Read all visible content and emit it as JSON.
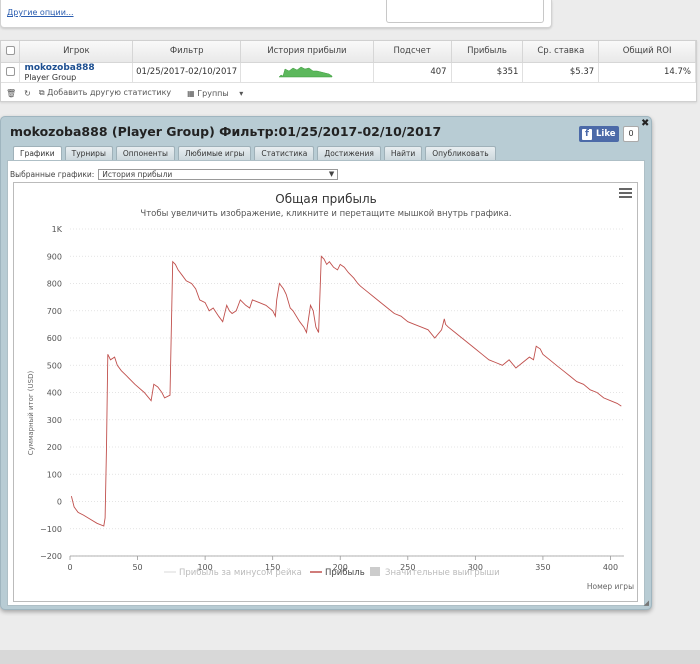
{
  "top_panel": {
    "other_options_link": "Другие опции..."
  },
  "stats_table": {
    "headers": [
      "Игрок",
      "Фильтр",
      "История прибыли",
      "Подсчет",
      "Прибыль",
      "Ср. ставка",
      "Общий ROI"
    ],
    "row": {
      "player_name": "mokozoba888",
      "player_site": "Player Group",
      "filter": "01/25/2017-02/10/2017",
      "count": "407",
      "profit": "$351",
      "avg_stake": "$5.37",
      "roi": "14.7%"
    },
    "toolbar": {
      "add_stat": "Добавить другую статистику",
      "groups": "Группы"
    }
  },
  "window": {
    "title": "mokozoba888 (Player Group) Фильтр:01/25/2017-02/10/2017",
    "fb_like": "Like",
    "fb_count": "0",
    "close": "✖",
    "tabs": [
      "Графики",
      "Турниры",
      "Оппоненты",
      "Любимые игры",
      "Статистика",
      "Достижения",
      "Найти",
      "Опубликовать"
    ],
    "active_tab": 0,
    "selected_charts_label": "Выбранные графики:",
    "selected_charts_value": "История прибыли"
  },
  "chart_data": {
    "type": "line",
    "title": "Общая прибыль",
    "subtitle": "Чтобы увеличить изображение, кликните и перетащите мышкой внутрь графика.",
    "ylabel": "Суммарный итог (USD)",
    "xlabel": "Номер игры",
    "xlim": [
      0,
      410
    ],
    "ylim": [
      -200,
      1000
    ],
    "x_ticks": [
      "0",
      "50",
      "100",
      "150",
      "200",
      "250",
      "300",
      "350",
      "400"
    ],
    "y_ticks": [
      "−200",
      "−100",
      "0",
      "100",
      "200",
      "300",
      "400",
      "500",
      "600",
      "700",
      "800",
      "900",
      "1K"
    ],
    "grid": true,
    "legend_position": "bottom",
    "legend": [
      "Прибыль за минусом рейка",
      "Прибыль",
      "Значительные выигрыши"
    ],
    "series": [
      {
        "name": "Прибыль",
        "color": "#c0504d",
        "x": [
          1,
          3,
          6,
          10,
          15,
          20,
          25,
          26,
          27,
          28,
          30,
          33,
          35,
          38,
          42,
          48,
          55,
          60,
          62,
          65,
          68,
          70,
          74,
          76,
          78,
          80,
          83,
          86,
          90,
          93,
          96,
          100,
          103,
          106,
          110,
          113,
          116,
          118,
          120,
          123,
          126,
          130,
          133,
          135,
          140,
          145,
          150,
          152,
          153,
          155,
          158,
          160,
          163,
          165,
          170,
          173,
          175,
          178,
          180,
          182,
          184,
          186,
          188,
          190,
          192,
          195,
          198,
          200,
          203,
          206,
          210,
          213,
          215,
          220,
          225,
          230,
          235,
          240,
          245,
          250,
          255,
          260,
          265,
          270,
          275,
          277,
          278,
          280,
          285,
          290,
          295,
          300,
          305,
          310,
          315,
          320,
          325,
          330,
          335,
          340,
          343,
          345,
          348,
          350,
          355,
          360,
          365,
          370,
          375,
          380,
          385,
          390,
          395,
          400,
          405,
          408
        ],
        "y": [
          20,
          -20,
          -40,
          -50,
          -65,
          -80,
          -90,
          -60,
          200,
          540,
          520,
          530,
          500,
          480,
          460,
          430,
          400,
          370,
          430,
          420,
          400,
          380,
          390,
          880,
          870,
          850,
          830,
          810,
          800,
          780,
          740,
          730,
          700,
          710,
          680,
          660,
          720,
          700,
          690,
          700,
          740,
          720,
          710,
          740,
          730,
          720,
          700,
          680,
          740,
          800,
          780,
          760,
          710,
          700,
          660,
          640,
          620,
          720,
          700,
          640,
          620,
          900,
          890,
          870,
          880,
          860,
          850,
          870,
          860,
          840,
          820,
          800,
          790,
          770,
          750,
          730,
          710,
          690,
          680,
          660,
          650,
          640,
          630,
          600,
          630,
          670,
          650,
          640,
          620,
          600,
          580,
          560,
          540,
          520,
          510,
          500,
          520,
          490,
          510,
          530,
          520,
          570,
          560,
          540,
          520,
          500,
          480,
          460,
          440,
          430,
          410,
          400,
          380,
          370,
          360,
          350
        ]
      }
    ]
  }
}
